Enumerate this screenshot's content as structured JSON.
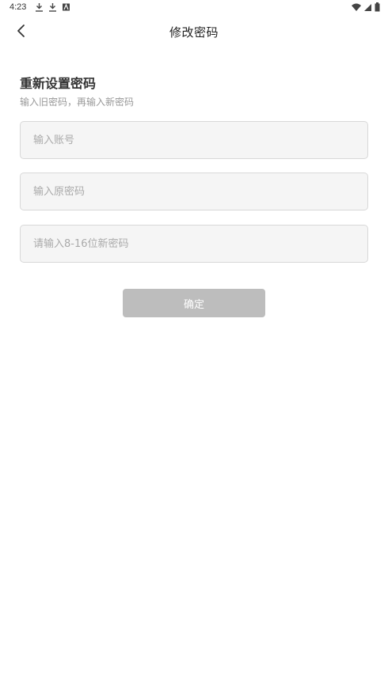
{
  "status_bar": {
    "time": "4:23",
    "left_icons": [
      "download-icon",
      "download-icon",
      "notification-a-icon"
    ],
    "right_icons": [
      "wifi-icon",
      "signal-icon",
      "battery-icon"
    ]
  },
  "header": {
    "back_icon": "chevron-left-icon",
    "title": "修改密码"
  },
  "form": {
    "heading": "重新设置密码",
    "subtitle": "输入旧密码，再输入新密码",
    "account_placeholder": "输入账号",
    "old_password_placeholder": "输入原密码",
    "new_password_placeholder": "请输入8-16位新密码",
    "confirm_label": "确定"
  },
  "colors": {
    "button_disabled": "#bdbdbd",
    "input_bg": "#f5f5f5",
    "input_border": "#d8d8d8",
    "placeholder": "#aaaaaa",
    "subtitle": "#999999"
  }
}
